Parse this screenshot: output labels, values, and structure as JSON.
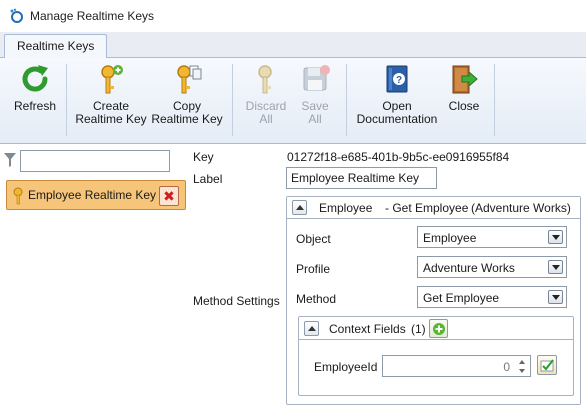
{
  "window": {
    "title": "Manage Realtime Keys",
    "app_icon": "ring-dots-icon"
  },
  "tabs": [
    {
      "label": "Realtime Keys",
      "active": true
    }
  ],
  "ribbon": {
    "refresh": {
      "label1": "Refresh",
      "label2": "",
      "icon": "refresh-icon",
      "enabled": true
    },
    "create": {
      "label1": "Create",
      "label2": "Realtime Key",
      "icon": "key-add-icon",
      "enabled": true
    },
    "copy": {
      "label1": "Copy",
      "label2": "Realtime Key",
      "icon": "key-copy-icon",
      "enabled": true
    },
    "discard": {
      "label1": "Discard",
      "label2": "All",
      "icon": "key-discard-icon",
      "enabled": false
    },
    "save": {
      "label1": "Save",
      "label2": "All",
      "icon": "floppy-save-icon",
      "enabled": false
    },
    "docs": {
      "label1": "Open",
      "label2": "Documentation",
      "icon": "help-book-icon",
      "enabled": true
    },
    "close": {
      "label1": "Close",
      "label2": "",
      "icon": "exit-door-icon",
      "enabled": true
    }
  },
  "left": {
    "filter_icon": "filter-icon",
    "filter_value": "",
    "items": [
      {
        "label": "Employee Realtime Key",
        "icon": "key-icon",
        "delete_icon": "delete-x-icon",
        "selected": true
      }
    ]
  },
  "details": {
    "key_label": "Key",
    "key_value": "01272f18-e685-401b-9b5c-ee0916955f84",
    "label_label": "Label",
    "label_value": "Employee Realtime Key",
    "method_settings_label": "Method Settings",
    "method_group": {
      "header_object": "Employee",
      "header_method": "- Get Employee",
      "header_profile": "(Adventure Works)",
      "object_label": "Object",
      "object_value": "Employee",
      "profile_label": "Profile",
      "profile_value": "Adventure Works",
      "method_label": "Method",
      "method_value": "Get Employee",
      "context": {
        "title": "Context Fields",
        "count": "(1)",
        "add_icon": "add-field-icon",
        "fields": [
          {
            "name": "EmployeeId",
            "value": "0",
            "action_icon": "edit-check-icon"
          }
        ]
      }
    }
  },
  "colors": {
    "selected_item_bg": "#f6c57a",
    "ribbon_bg": "#e4ecf6",
    "disabled_text": "#9aa3ad"
  }
}
